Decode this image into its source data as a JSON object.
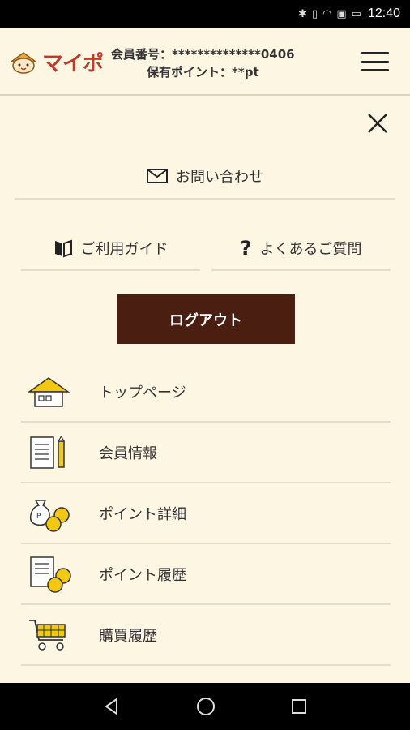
{
  "status_bar": {
    "time": "12:40"
  },
  "header": {
    "logo_text": "マイポ",
    "member_label": "会員番号：",
    "member_number": "**************0406",
    "points_label": "保有ポイント：",
    "points_value": "**pt"
  },
  "drawer": {
    "contact_label": "お問い合わせ",
    "guide_label": "ご利用ガイド",
    "faq_label": "よくあるご質問",
    "logout_label": "ログアウト",
    "menu": [
      {
        "label": "トップページ",
        "icon": "house-icon"
      },
      {
        "label": "会員情報",
        "icon": "document-pencil-icon"
      },
      {
        "label": "ポイント詳細",
        "icon": "coin-bag-icon"
      },
      {
        "label": "ポイント履歴",
        "icon": "document-coins-icon"
      },
      {
        "label": "購買履歴",
        "icon": "shopping-cart-icon"
      }
    ]
  },
  "colors": {
    "background": "#fcf6e3",
    "logout_button": "#4a1e10",
    "logo": "#c0392b",
    "coin": "#f2c811"
  }
}
